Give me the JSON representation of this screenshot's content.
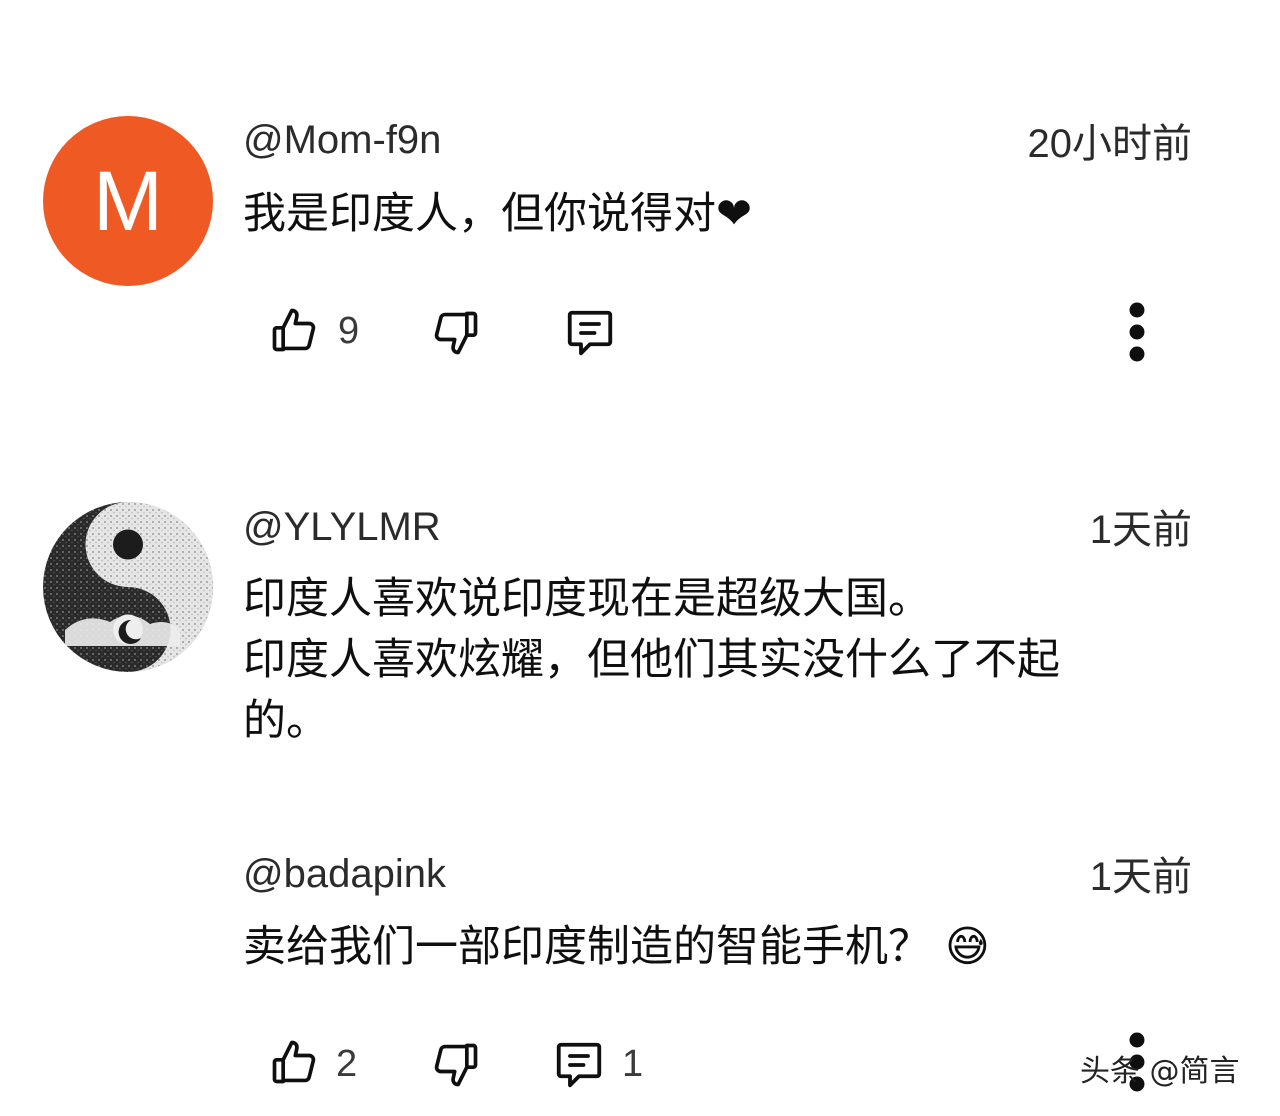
{
  "comments": [
    {
      "avatar_letter": "M",
      "avatar_color": "#ef5a24",
      "handle": "@Mom-f9n",
      "time": "20小时前",
      "text": "我是印度人，但你说得对❤",
      "likes": "9",
      "replies": ""
    },
    {
      "avatar_icon": "yin-yang-avatar",
      "handle": "@YLYLMR",
      "time": "1天前",
      "text": "印度人喜欢说印度现在是超级大国。\n印度人喜欢炫耀，但他们其实没什么了不起\n的。"
    },
    {
      "handle": "@badapink",
      "time": "1天前",
      "text": "卖给我们一部印度制造的智能手机？",
      "emoji": "😅",
      "likes": "2",
      "replies": "1"
    }
  ],
  "icons": {
    "like": "thumbs-up-icon",
    "dislike": "thumbs-down-icon",
    "reply": "comment-icon",
    "more": "more-vertical-icon"
  },
  "watermark": "头条 @简言"
}
